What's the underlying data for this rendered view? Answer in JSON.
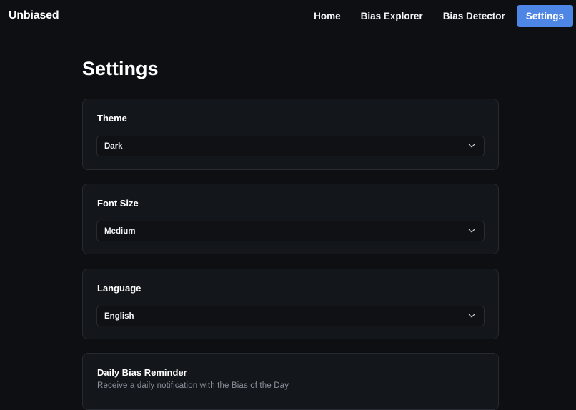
{
  "nav": {
    "brand": "Unbiased",
    "links": [
      {
        "label": "Home"
      },
      {
        "label": "Bias Explorer"
      },
      {
        "label": "Bias Detector"
      },
      {
        "label": "Settings",
        "active": true
      }
    ]
  },
  "page": {
    "title": "Settings"
  },
  "settings": {
    "theme": {
      "label": "Theme",
      "value": "Dark"
    },
    "font_size": {
      "label": "Font Size",
      "value": "Medium"
    },
    "language": {
      "label": "Language",
      "value": "English"
    },
    "reminder": {
      "label": "Daily Bias Reminder",
      "description": "Receive a daily notification with the Bias of the Day"
    }
  },
  "colors": {
    "accent": "#4e86e6",
    "background": "#0d0f13",
    "card": "#13161b"
  }
}
